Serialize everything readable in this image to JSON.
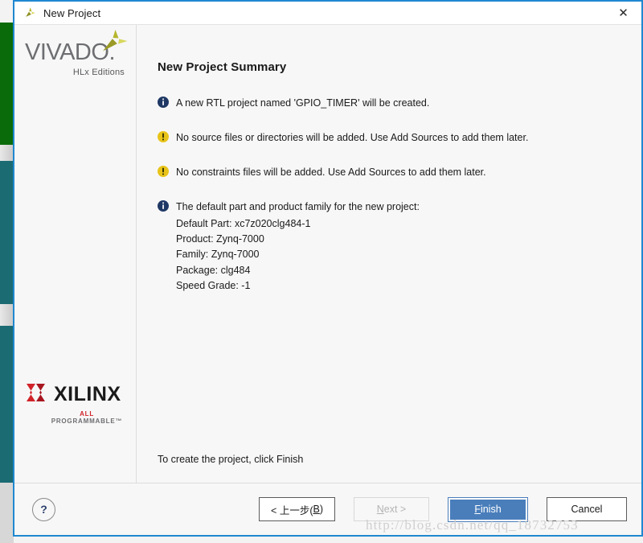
{
  "window": {
    "title": "New Project",
    "app_icon": "vivado-logo-icon",
    "close_icon": "close-icon"
  },
  "sidebar": {
    "vivado": {
      "wordmark": "VIVADO",
      "dot": ".",
      "subtitle": "HLx Editions",
      "swoosh_color": "#c8c832"
    },
    "xilinx": {
      "wordmark": "XILINX",
      "tagline_accent": "ALL",
      "tagline_rest": " PROGRAMMABLE™",
      "mark_color": "#d1232a"
    }
  },
  "main": {
    "heading": "New Project Summary",
    "items": [
      {
        "icon": "info-icon",
        "icon_color": "#1f3864",
        "text": "A new RTL project named 'GPIO_TIMER' will be created."
      },
      {
        "icon": "warning-icon",
        "icon_color": "#e8c41a",
        "text": "No source files or directories will be added. Use Add Sources to add them later."
      },
      {
        "icon": "warning-icon",
        "icon_color": "#e8c41a",
        "text": "No constraints files will be added. Use Add Sources to add them later."
      }
    ],
    "part_details": {
      "icon": "info-icon",
      "icon_color": "#1f3864",
      "text": "The default part and product family for the new project:",
      "lines": [
        "Default Part: xc7z020clg484-1",
        "Product: Zynq-7000",
        "Family: Zynq-7000",
        "Package: clg484",
        "Speed Grade: -1"
      ]
    },
    "finish_hint": "To create the project, click Finish"
  },
  "footer": {
    "help_label": "?",
    "buttons": {
      "back": {
        "prefix": "< 上一步(",
        "accel": "B",
        "suffix": ")"
      },
      "next": {
        "prefix": "",
        "accel": "N",
        "suffix": "ext >"
      },
      "finish": {
        "prefix": "",
        "accel": "F",
        "suffix": "inish"
      },
      "cancel": {
        "label": "Cancel"
      }
    }
  },
  "watermark": {
    "text": "http://blog.csdn.net/qq_18732753"
  },
  "colors": {
    "dialog_border": "#1f88d0",
    "finish_blue": "#4a7ebb",
    "backdrop_green": "#0a6b0a",
    "backdrop_teal": "#1b6b73"
  }
}
